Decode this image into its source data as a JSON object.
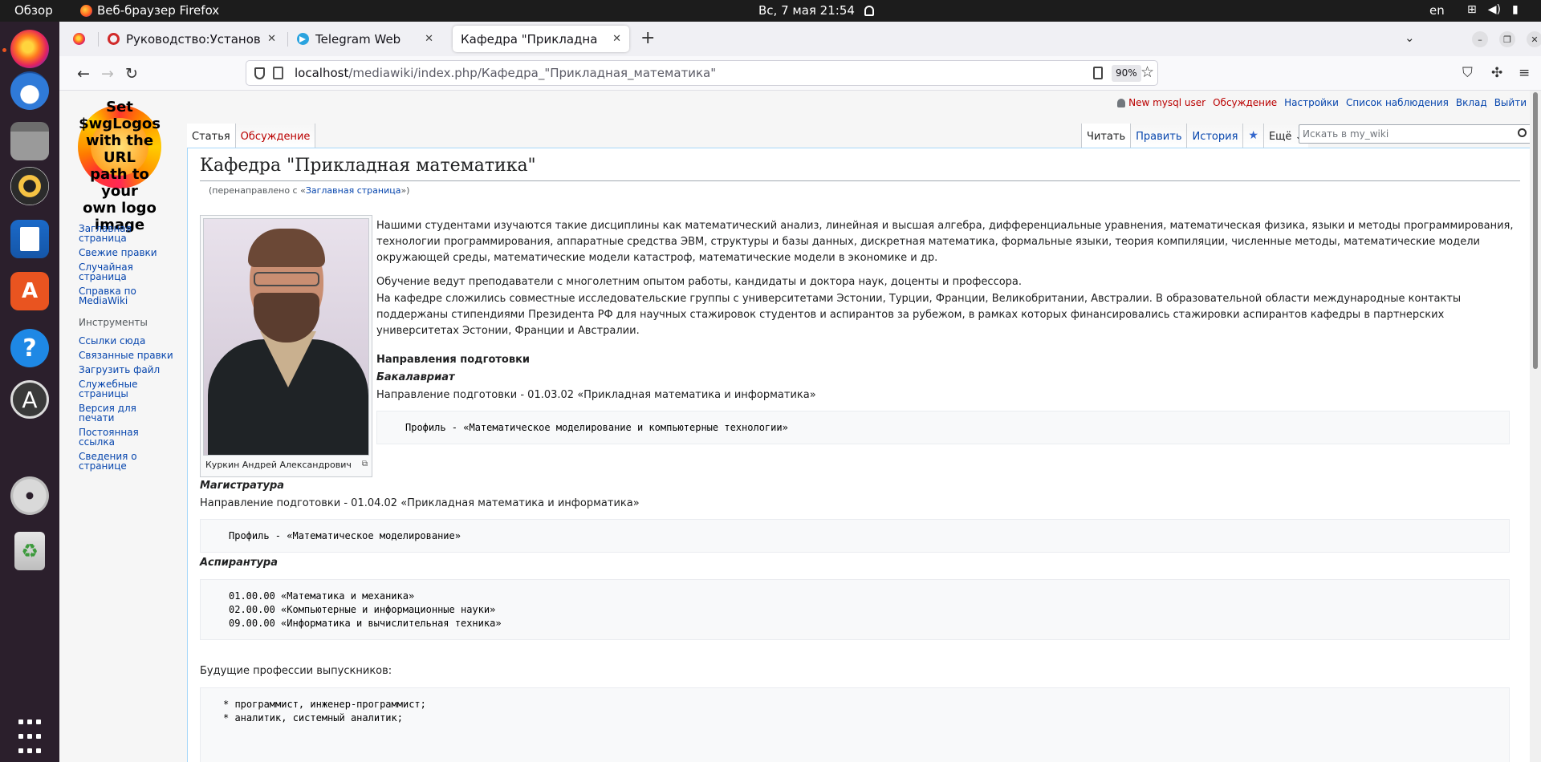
{
  "topbar": {
    "activities": "Обзор",
    "app_name": "Веб-браузер Firefox",
    "clock": "Вс, 7 мая  21:54",
    "lang": "en"
  },
  "dock": {
    "items": [
      "firefox",
      "thunderbird",
      "files",
      "rhythmbox",
      "libreoffice-writer",
      "app-center",
      "help",
      "software-updater",
      "dvd",
      "trash",
      "show-apps"
    ]
  },
  "browser": {
    "tabs": [
      {
        "title": "Руководство:Установка"
      },
      {
        "title": "Telegram Web"
      },
      {
        "title": "Кафедра \"Прикладная мате"
      }
    ],
    "url_host": "localhost",
    "url_path": "/mediawiki/index.php/Кафедра_\"Прикладная_математика\"",
    "zoom": "90%"
  },
  "wiki": {
    "logo_text": [
      "Set",
      "$wgLogos",
      "with the URL",
      "path to your",
      "own logo",
      "image"
    ],
    "user_links": {
      "user": "New mysql user",
      "talk": "Обсуждение",
      "prefs": "Настройки",
      "watchlist": "Список наблюдения",
      "contribs": "Вклад",
      "logout": "Выйти"
    },
    "nav_links": [
      "Заглавная страница",
      "Свежие правки",
      "Случайная страница",
      "Справка по MediaWiki"
    ],
    "tools_heading": "Инструменты",
    "tool_links": [
      "Ссылки сюда",
      "Связанные правки",
      "Загрузить файл",
      "Служебные страницы",
      "Версия для печати",
      "Постоянная ссылка",
      "Сведения о странице"
    ],
    "page_tabs": {
      "article": "Статья",
      "discussion": "Обсуждение"
    },
    "view_tabs": {
      "read": "Читать",
      "edit": "Править",
      "history": "История",
      "more": "Ещё"
    },
    "search_placeholder": "Искать в my_wiki",
    "title": "Кафедра \"Прикладная математика\"",
    "redirect_prefix": "(перенаправлено с «",
    "redirect_link": "Заглавная страница",
    "redirect_suffix": "»)",
    "image_caption": "Куркин Андрей Александрович",
    "para1": "Нашими студентами изучаются такие дисциплины как математический анализ, линейная и высшая алгебра, дифференциальные уравнения, математическая физика, языки и методы программирования, технологии программирования, аппаратные средства ЭВМ, структуры и базы данных, дискретная математика, формальные языки, теория компиляции, численные методы, математические модели окружающей среды, математические модели катастроф, математические модели в экономике и др.",
    "para2": "Обучение ведут преподаватели с многолетним опытом работы, кандидаты и доктора наук, доценты и профессора.",
    "para3": "На кафедре сложились совместные исследовательские группы с университетами Эстонии, Турции, Франции, Великобритании, Австралии. В образовательной области международные контакты поддержаны стипендиями Президента РФ для научных стажировок студентов и аспирантов за рубежом, в рамках которых финансировались стажировки аспирантов кафедры в партнерских университетах Эстонии, Франции и Австралии.",
    "heading_directions": "Направления подготовки",
    "bachelor": {
      "heading": "Бакалавриат",
      "direction": "Направление подготовки - 01.03.02 «Прикладная математика и информатика»",
      "profile": "Профиль - «Математическое моделирование и компьютерные технологии»"
    },
    "master": {
      "heading": "Магистратура",
      "direction": "Направление подготовки - 01.04.02 «Прикладная математика и информатика»",
      "profile": "Профиль - «Математическое моделирование»"
    },
    "phd": {
      "heading": "Аспирантура",
      "lines": [
        "01.00.00 «Математика и механика»",
        "02.00.00 «Компьютерные и информационные науки»",
        "09.00.00 «Информатика и вычислительная техника»"
      ]
    },
    "careers_heading": "Будущие профессии выпускников:",
    "careers": [
      "* программист, инженер-программист;",
      "* аналитик, системный аналитик;"
    ]
  }
}
